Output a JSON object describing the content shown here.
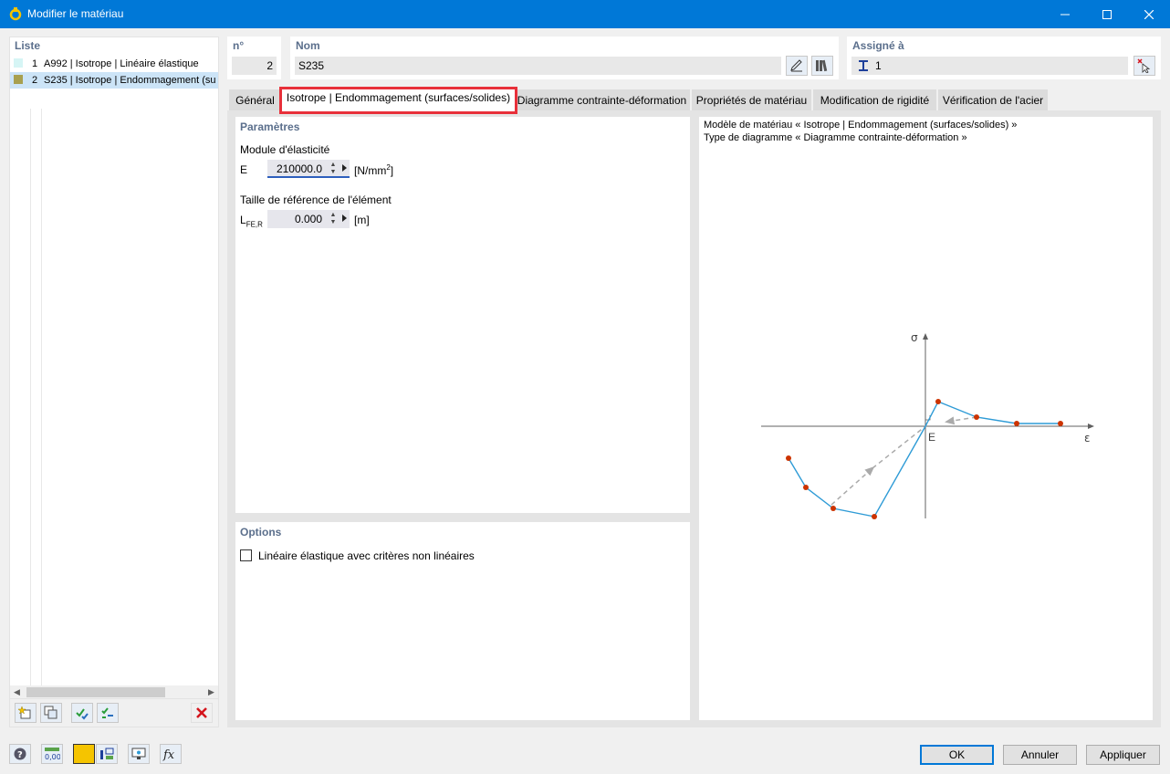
{
  "window": {
    "title": "Modifier le matériau"
  },
  "list": {
    "label": "Liste",
    "items": [
      {
        "num": "1",
        "text": "A992 | Isotrope | Linéaire élastique",
        "color": "#d6f5f5"
      },
      {
        "num": "2",
        "text": "S235 | Isotrope | Endommagement (su",
        "color": "#a8a050"
      }
    ]
  },
  "header": {
    "no_label": "n°",
    "no_value": "2",
    "name_label": "Nom",
    "name_value": "S235",
    "assigned_label": "Assigné à",
    "assigned_value": "1"
  },
  "tabs": [
    "Général",
    "Isotrope | Endommagement (surfaces/solides)",
    "Diagramme contrainte-déformation",
    "Propriétés de matériau",
    "Modification de rigidité",
    "Vérification de l'acier"
  ],
  "params": {
    "label": "Paramètres",
    "elasticity_label": "Module d'élasticité",
    "e_symbol": "E",
    "e_value": "210000.0",
    "e_unit_base": "[N/mm",
    "e_unit_exp": "2",
    "e_unit_close": "]",
    "ref_size_label": "Taille de référence de l'élément",
    "lfe_symbol": "L",
    "lfe_sub": "FE,R",
    "lfe_value": "0.000",
    "lfe_unit": "[m]"
  },
  "options": {
    "label": "Options",
    "checkbox_label": "Linéaire élastique avec critères non linéaires",
    "checked": false
  },
  "diagram": {
    "line1": "Modèle de matériau « Isotrope | Endommagement (surfaces/solides) »",
    "line2": "Type de diagramme « Diagramme contrainte-déformation »",
    "sigma": "σ",
    "epsilon": "ε",
    "e_marker": "E",
    "curve_color": "#2e9bd6",
    "point_color": "#cc3300"
  },
  "buttons": {
    "ok": "OK",
    "cancel": "Annuler",
    "apply": "Appliquer"
  },
  "colors": {
    "titlebar": "#0078d7",
    "active_tab_border": "#e8303a",
    "bottom_color_swatch": "#f5c400"
  }
}
